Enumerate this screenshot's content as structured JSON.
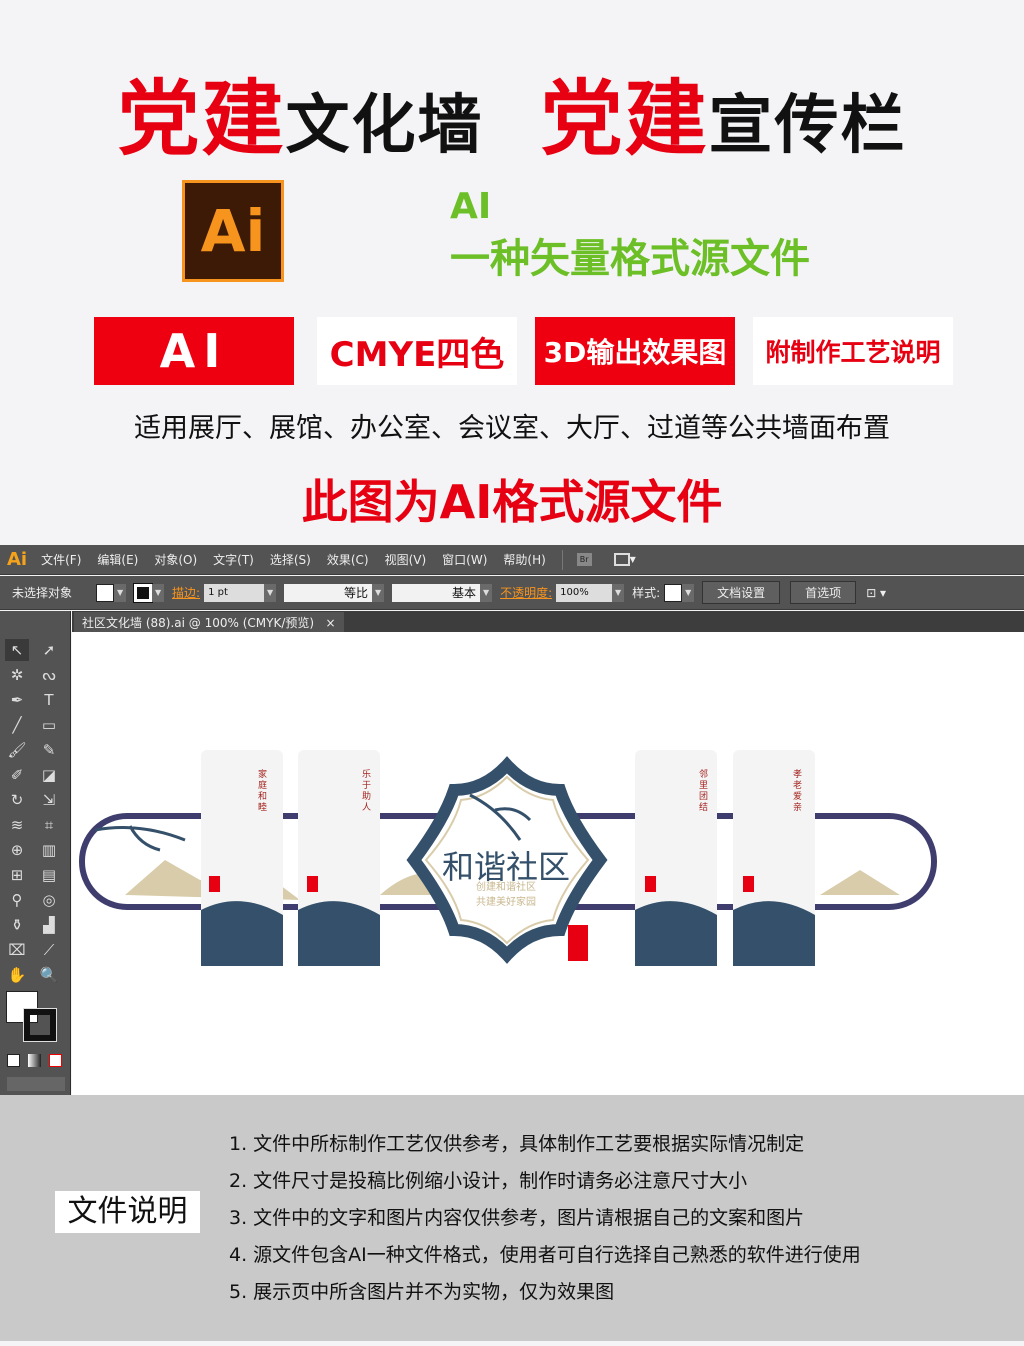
{
  "poster": {
    "title_parts": [
      "党建",
      "文化墙",
      "党建",
      "宣传栏"
    ],
    "ai_logo": "Ai",
    "green_line1": "AI",
    "green_line2": "一种矢量格式源文件",
    "badges": [
      "AI",
      "CMYE四色",
      "3D输出效果图",
      "附制作工艺说明"
    ],
    "usage": "适用展厅、展馆、办公室、会议室、大厅、过道等公共墙面布置",
    "note": "此图为AI格式源文件",
    "colors": {
      "red": "#e60012",
      "green": "#6cbf27",
      "ai_brown": "#3d1a05",
      "ai_orange": "#f7941d"
    }
  },
  "illustrator": {
    "logo": "Ai",
    "menu": [
      "文件(F)",
      "编辑(E)",
      "对象(O)",
      "文字(T)",
      "选择(S)",
      "效果(C)",
      "视图(V)",
      "窗口(W)",
      "帮助(H)"
    ],
    "bridge": "Br",
    "control": {
      "selection": "未选择对象",
      "stroke_label": "描边:",
      "stroke_value": "1 pt",
      "profile": "等比",
      "brush": "基本",
      "opacity_label": "不透明度:",
      "opacity_value": "100%",
      "style_label": "样式:",
      "doc_setup": "文档设置",
      "preferences": "首选项"
    },
    "tab": {
      "title": "社区文化墙 (88).ai @ 100% (CMYK/预览)",
      "close": "×"
    },
    "artwork": {
      "center_title": "和谐社区",
      "center_sub1": "创建和谐社区",
      "center_sub2": "共建美好家园",
      "panels": [
        "家庭和睦",
        "乐于助人",
        "邻里团结",
        "孝老爱亲"
      ],
      "colors": {
        "navy": "#34506a",
        "track": "#3f3d6e",
        "beige": "#d9ccaa",
        "seal": "#e60012"
      }
    }
  },
  "bottom": {
    "label": "文件说明",
    "notes": [
      "1. 文件中所标制作工艺仅供参考，具体制作工艺要根据实际情况制定",
      "2. 文件尺寸是投稿比例缩小设计，制作时请务必注意尺寸大小",
      "3. 文件中的文字和图片内容仅供参考，图片请根据自己的文案和图片",
      "4. 源文件包含AI一种文件格式，使用者可自行选择自己熟悉的软件进行使用",
      "5. 展示页中所含图片并不为实物，仅为效果图"
    ]
  }
}
